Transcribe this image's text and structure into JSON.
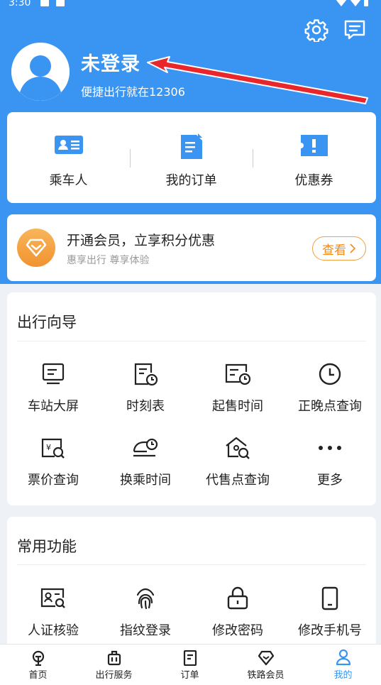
{
  "status": {
    "time": "3:30"
  },
  "profile": {
    "title": "未登录",
    "subtitle": "便捷出行就在12306"
  },
  "quick": [
    {
      "label": "乘车人",
      "icon": "passenger-card-icon"
    },
    {
      "label": "我的订单",
      "icon": "order-doc-icon"
    },
    {
      "label": "优惠券",
      "icon": "coupon-icon"
    }
  ],
  "member": {
    "title": "开通会员，立享积分优惠",
    "subtitle": "惠享出行 尊享体验",
    "button": "查看"
  },
  "guide": {
    "title": "出行向导",
    "items": [
      {
        "label": "车站大屏",
        "icon": "station-screen-icon"
      },
      {
        "label": "时刻表",
        "icon": "timetable-icon"
      },
      {
        "label": "起售时间",
        "icon": "sale-time-icon"
      },
      {
        "label": "正晚点查询",
        "icon": "clock-icon"
      },
      {
        "label": "票价查询",
        "icon": "fare-search-icon"
      },
      {
        "label": "换乘时间",
        "icon": "transfer-time-icon"
      },
      {
        "label": "代售点查询",
        "icon": "agency-search-icon"
      },
      {
        "label": "更多",
        "icon": "more-icon"
      }
    ]
  },
  "common": {
    "title": "常用功能",
    "items": [
      {
        "label": "人证核验",
        "icon": "id-verify-icon"
      },
      {
        "label": "指纹登录",
        "icon": "fingerprint-icon"
      },
      {
        "label": "修改密码",
        "icon": "lock-icon"
      },
      {
        "label": "修改手机号",
        "icon": "phone-icon"
      }
    ]
  },
  "tabs": [
    {
      "label": "首页",
      "icon": "home-train-icon"
    },
    {
      "label": "出行服务",
      "icon": "luggage-icon"
    },
    {
      "label": "订单",
      "icon": "order-icon"
    },
    {
      "label": "铁路会员",
      "icon": "diamond-icon"
    },
    {
      "label": "我的",
      "icon": "person-icon",
      "active": true
    }
  ],
  "colors": {
    "brand": "#3a95f2",
    "accent": "#f08a1e",
    "arrow": "#e8262b"
  }
}
